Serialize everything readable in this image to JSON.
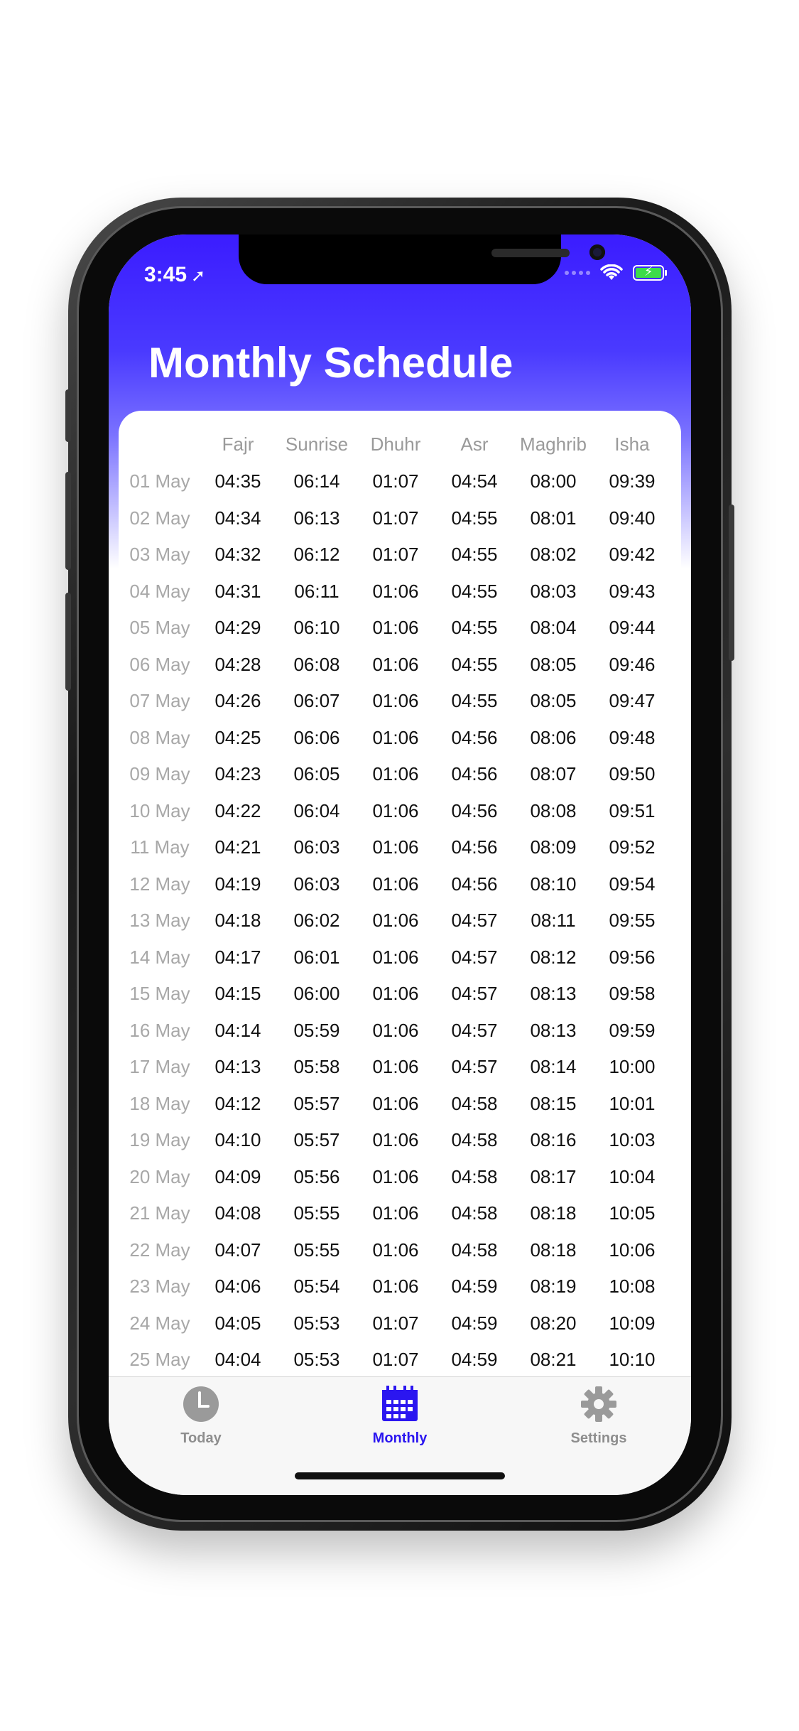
{
  "status_bar": {
    "time": "3:45",
    "location_arrow": "➤"
  },
  "title": "Monthly Schedule",
  "columns": [
    "Fajr",
    "Sunrise",
    "Dhuhr",
    "Asr",
    "Maghrib",
    "Isha"
  ],
  "rows": [
    [
      "01 May",
      "04:35",
      "06:14",
      "01:07",
      "04:54",
      "08:00",
      "09:39"
    ],
    [
      "02 May",
      "04:34",
      "06:13",
      "01:07",
      "04:55",
      "08:01",
      "09:40"
    ],
    [
      "03 May",
      "04:32",
      "06:12",
      "01:07",
      "04:55",
      "08:02",
      "09:42"
    ],
    [
      "04 May",
      "04:31",
      "06:11",
      "01:06",
      "04:55",
      "08:03",
      "09:43"
    ],
    [
      "05 May",
      "04:29",
      "06:10",
      "01:06",
      "04:55",
      "08:04",
      "09:44"
    ],
    [
      "06 May",
      "04:28",
      "06:08",
      "01:06",
      "04:55",
      "08:05",
      "09:46"
    ],
    [
      "07 May",
      "04:26",
      "06:07",
      "01:06",
      "04:55",
      "08:05",
      "09:47"
    ],
    [
      "08 May",
      "04:25",
      "06:06",
      "01:06",
      "04:56",
      "08:06",
      "09:48"
    ],
    [
      "09 May",
      "04:23",
      "06:05",
      "01:06",
      "04:56",
      "08:07",
      "09:50"
    ],
    [
      "10 May",
      "04:22",
      "06:04",
      "01:06",
      "04:56",
      "08:08",
      "09:51"
    ],
    [
      "11 May",
      "04:21",
      "06:03",
      "01:06",
      "04:56",
      "08:09",
      "09:52"
    ],
    [
      "12 May",
      "04:19",
      "06:03",
      "01:06",
      "04:56",
      "08:10",
      "09:54"
    ],
    [
      "13 May",
      "04:18",
      "06:02",
      "01:06",
      "04:57",
      "08:11",
      "09:55"
    ],
    [
      "14 May",
      "04:17",
      "06:01",
      "01:06",
      "04:57",
      "08:12",
      "09:56"
    ],
    [
      "15 May",
      "04:15",
      "06:00",
      "01:06",
      "04:57",
      "08:13",
      "09:58"
    ],
    [
      "16 May",
      "04:14",
      "05:59",
      "01:06",
      "04:57",
      "08:13",
      "09:59"
    ],
    [
      "17 May",
      "04:13",
      "05:58",
      "01:06",
      "04:57",
      "08:14",
      "10:00"
    ],
    [
      "18 May",
      "04:12",
      "05:57",
      "01:06",
      "04:58",
      "08:15",
      "10:01"
    ],
    [
      "19 May",
      "04:10",
      "05:57",
      "01:06",
      "04:58",
      "08:16",
      "10:03"
    ],
    [
      "20 May",
      "04:09",
      "05:56",
      "01:06",
      "04:58",
      "08:17",
      "10:04"
    ],
    [
      "21 May",
      "04:08",
      "05:55",
      "01:06",
      "04:58",
      "08:18",
      "10:05"
    ],
    [
      "22 May",
      "04:07",
      "05:55",
      "01:06",
      "04:58",
      "08:18",
      "10:06"
    ],
    [
      "23 May",
      "04:06",
      "05:54",
      "01:06",
      "04:59",
      "08:19",
      "10:08"
    ],
    [
      "24 May",
      "04:05",
      "05:53",
      "01:07",
      "04:59",
      "08:20",
      "10:09"
    ],
    [
      "25 May",
      "04:04",
      "05:53",
      "01:07",
      "04:59",
      "08:21",
      "10:10"
    ]
  ],
  "tabs": [
    {
      "label": "Today",
      "icon": "clock-icon",
      "active": false
    },
    {
      "label": "Monthly",
      "icon": "calendar-icon",
      "active": true
    },
    {
      "label": "Settings",
      "icon": "gear-icon",
      "active": false
    }
  ],
  "colors": {
    "accent": "#2b16f0",
    "header_gradient_top": "#3b1cff",
    "inactive_tab": "#8e8e8e"
  }
}
